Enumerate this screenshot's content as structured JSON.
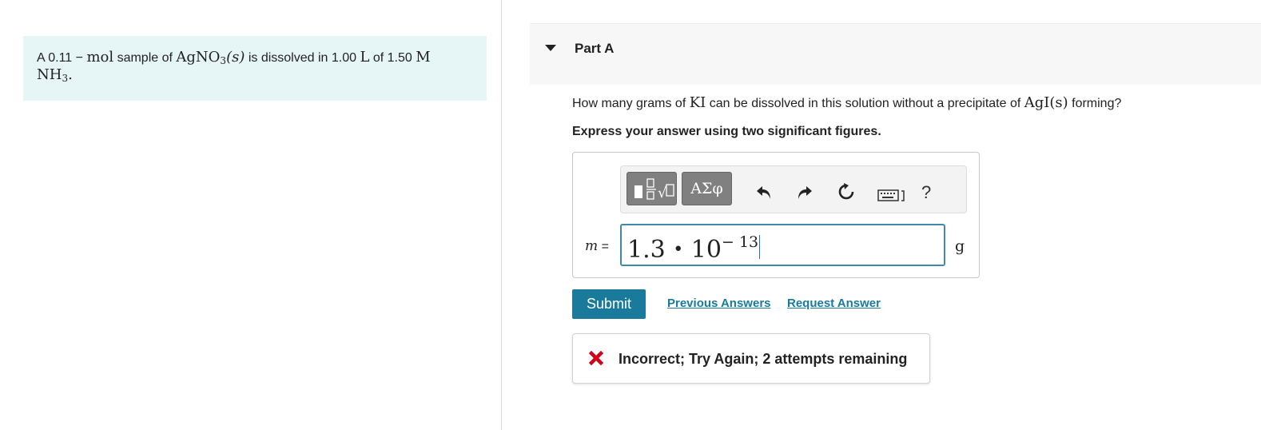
{
  "intro": {
    "prefix": "A 0.11",
    "dash": "−",
    "unit_mol": "mol",
    "mid": "sample of",
    "formula_main": "AgNO",
    "formula_sub": "3",
    "formula_state": "(s)",
    "middle_text": "is dissolved in 1.00",
    "unit_L": "L",
    "of_text": "of 1.50",
    "unit_M": "M",
    "nh3_main": "NH",
    "nh3_sub": "3",
    "period": "."
  },
  "part": {
    "title": "Part A"
  },
  "question": {
    "text_before": "How many grams of",
    "compound": "KI",
    "text_middle": "can be dissolved in this solution without a precipitate of",
    "precipitate": "AgI(s)",
    "text_after": "forming?"
  },
  "instruction": "Express your answer using two significant figures.",
  "toolbar": {
    "templates_icon": "templates-icon",
    "greek_label": "ΑΣφ",
    "undo_icon": "undo-icon",
    "redo_icon": "redo-icon",
    "reset_icon": "reset-icon",
    "keyboard_icon": "keyboard-icon",
    "help_label": "?"
  },
  "answer": {
    "variable": "m",
    "equals": "=",
    "mantissa": "1.3",
    "times": "•",
    "base": "10",
    "exponent": "− 13",
    "unit": "g"
  },
  "actions": {
    "submit_label": "Submit",
    "previous_answers": "Previous Answers",
    "request_answer": "Request Answer"
  },
  "feedback": {
    "icon": "x-icon",
    "message": "Incorrect; Try Again; 2 attempts remaining",
    "color": "#d0021b"
  },
  "colors": {
    "intro_bg": "#e6f6f7",
    "accent": "#1a7a9c",
    "input_border": "#3f8aa8"
  }
}
